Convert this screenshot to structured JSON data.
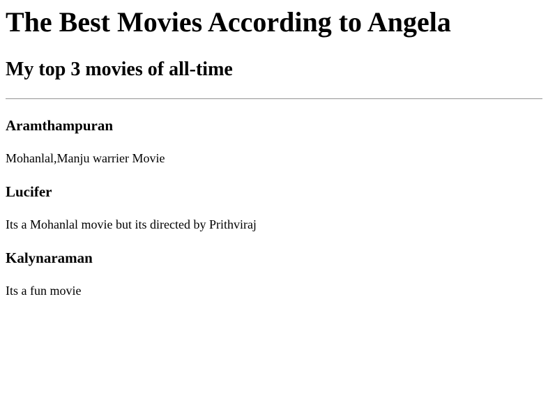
{
  "page": {
    "title": "The Best Movies According to Angela",
    "subtitle": "My top 3 movies of all-time"
  },
  "movies": [
    {
      "title": "Aramthampuran",
      "description": "Mohanlal,Manju warrier Movie"
    },
    {
      "title": "Lucifer",
      "description": "Its a Mohanlal movie but its directed by Prithviraj"
    },
    {
      "title": "Kalynaraman",
      "description": "Its a fun movie"
    }
  ]
}
